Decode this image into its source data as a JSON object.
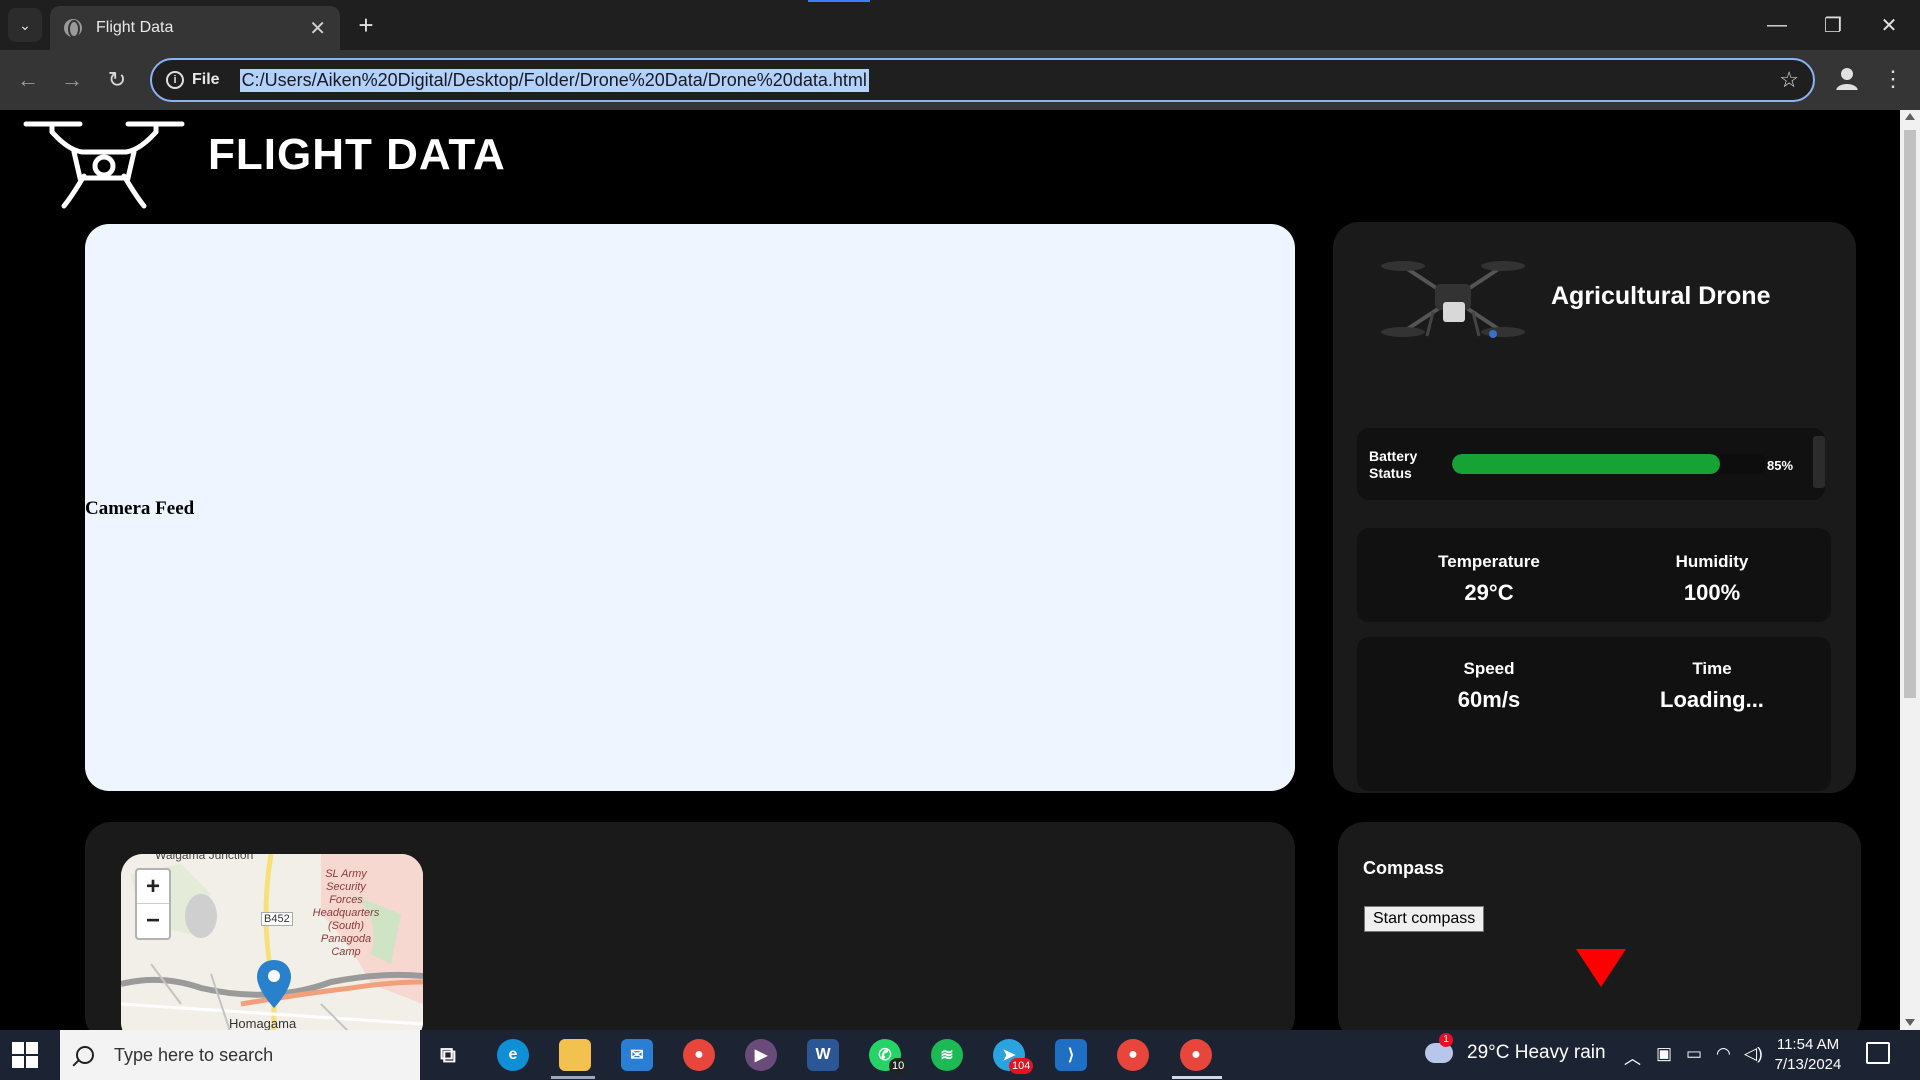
{
  "browser": {
    "tab_title": "Flight Data",
    "new_tab_label": "+",
    "close_tab_label": "✕",
    "scheme_label": "File",
    "url": "C:/Users/Aiken%20Digital/Desktop/Folder/Drone%20Data/Drone%20data.html"
  },
  "page": {
    "title": "FLIGHT DATA",
    "camera_label": "Camera Feed",
    "drone_name": "Agricultural Drone",
    "battery": {
      "label": "Battery Status",
      "percent": 85,
      "percent_text": "85%"
    },
    "stats": {
      "temperature_label": "Temperature",
      "temperature_value": "29°C",
      "humidity_label": "Humidity",
      "humidity_value": "100%",
      "speed_label": "Speed",
      "speed_value": "60m/s",
      "time_label": "Time",
      "time_value": "Loading..."
    },
    "map": {
      "zoom_in": "+",
      "zoom_out": "−",
      "labels": [
        "Walgama Junction",
        "SL Army Security Forces Headquarters (South) Panagoda Camp",
        "B452",
        "Homagama"
      ]
    },
    "compass": {
      "title": "Compass",
      "button_label": "Start compass"
    }
  },
  "taskbar": {
    "search_placeholder": "Type here to search",
    "whatsapp_badge": "10",
    "telegram_badge": "104",
    "weather": "29°C  Heavy rain",
    "time": "11:54 AM",
    "date": "7/13/2024"
  },
  "colors": {
    "battery_fill": "#16a234",
    "compass_arrow": "#ff0000",
    "camera_bg": "#eef5ff"
  }
}
